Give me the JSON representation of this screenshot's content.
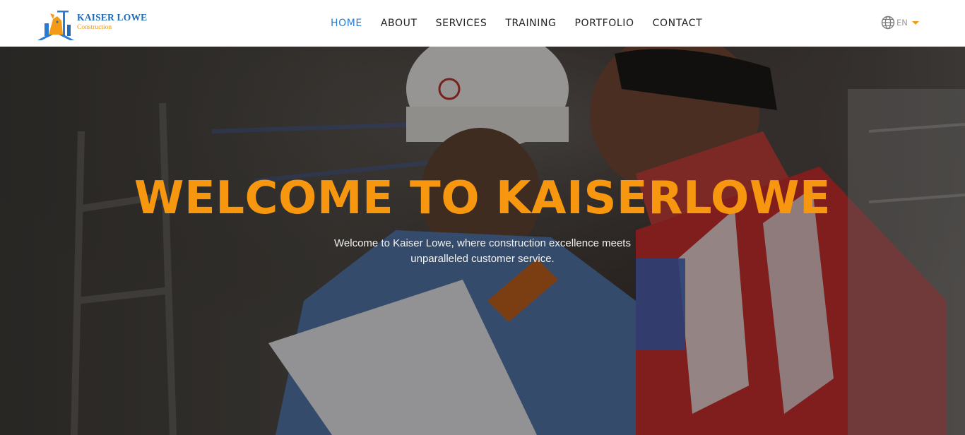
{
  "brand": {
    "name": "KAISER LOWE",
    "tagline": "Construction"
  },
  "nav": {
    "items": [
      {
        "label": "HOME",
        "active": true
      },
      {
        "label": "ABOUT",
        "active": false
      },
      {
        "label": "SERVICES",
        "active": false
      },
      {
        "label": "TRAINING",
        "active": false
      },
      {
        "label": "PORTFOLIO",
        "active": false
      },
      {
        "label": "CONTACT",
        "active": false
      }
    ]
  },
  "language": {
    "icon": "globe-icon",
    "selected": "EN"
  },
  "hero": {
    "title": "WELCOME TO KAISERLOWE",
    "subtitle": "Welcome to Kaiser Lowe, where construction excellence meets unparalleled customer service."
  },
  "colors": {
    "accent": "#f7960f",
    "nav_active": "#2a7bd1",
    "brand_blue": "#1e6bb8"
  }
}
